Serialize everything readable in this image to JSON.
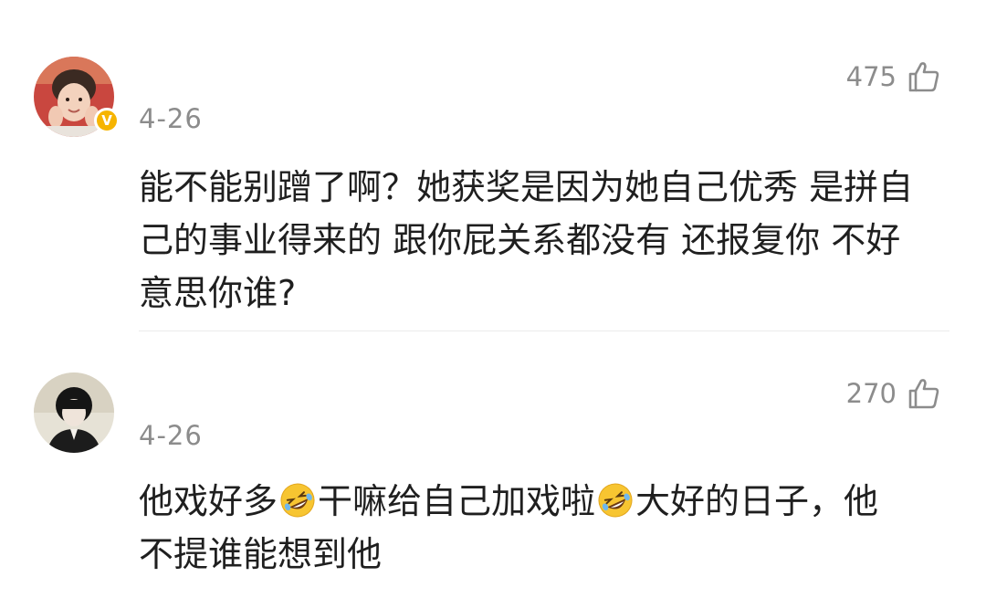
{
  "comments": [
    {
      "date": "4-26",
      "likes": "475",
      "avatar_icon": "avatar-user-photo",
      "verified_label": "V",
      "verified_color": "#f6b400",
      "text_lines": [
        "能不能别蹭了啊？她获奖是因为她自己优秀 是拼自",
        "己的事业得来的 跟你屁关系都没有 还报复你 不好",
        "意思你谁?"
      ]
    },
    {
      "date": "4-26",
      "likes": "270",
      "avatar_icon": "avatar-user-photo",
      "text_line1_parts": [
        "他戏好多",
        "干嘛给自己加戏啦",
        "大好的日子，他"
      ],
      "emoji": "rolling-on-floor-laughing-emoji",
      "text_line2": "不提谁能想到他"
    }
  ],
  "colors": {
    "meta_text": "#8c8c8c",
    "body_text": "#1f1f1f",
    "divider": "#ececec"
  }
}
